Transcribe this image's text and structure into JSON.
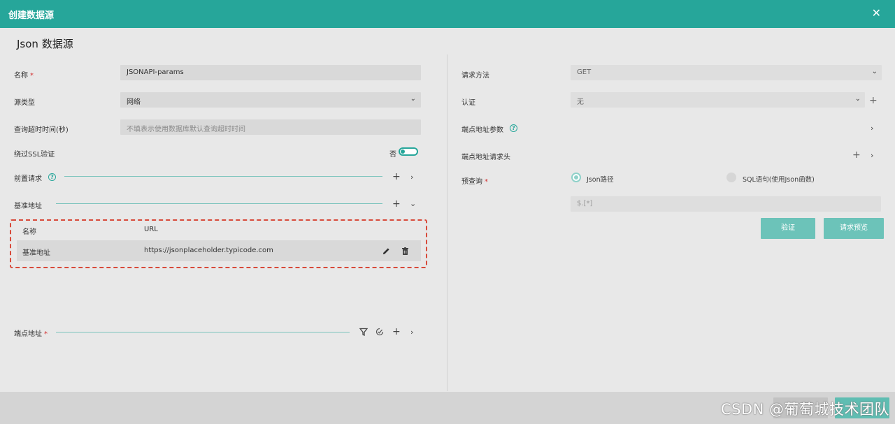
{
  "dialog": {
    "title": "创建数据源"
  },
  "heading": "Json 数据源",
  "left": {
    "name_label": "名称",
    "name_value": "JSONAPI-params",
    "source_type_label": "源类型",
    "source_type_value": "网络",
    "timeout_label": "查询超时时间(秒)",
    "timeout_placeholder": "不填表示使用数据库默认查询超时时间",
    "ssl_label": "绕过SSL验证",
    "ssl_state": "否",
    "pre_request_label": "前置请求",
    "base_url_label": "基准地址",
    "table": {
      "headers": [
        "名称",
        "URL"
      ],
      "rows": [
        {
          "name": "基准地址",
          "url": "https://jsonplaceholder.typicode.com"
        }
      ]
    },
    "endpoint_label": "端点地址"
  },
  "right": {
    "method_label": "请求方法",
    "method_value": "GET",
    "auth_label": "认证",
    "auth_value": "无",
    "endpoint_params_label": "端点地址参数",
    "endpoint_headers_label": "端点地址请求头",
    "pre_query_label": "预查询",
    "radio_json": "Json路径",
    "radio_sql": "SQL语句(使用Json函数)",
    "json_path_placeholder": "$.[*]",
    "verify_button": "验证",
    "preview_button": "请求预览"
  },
  "watermark": "CSDN @葡萄城技术团队",
  "colors": {
    "accent": "#26a69a",
    "required": "#d32f2f",
    "highlight_border": "#d84a3a"
  },
  "icons": [
    "close-icon",
    "chevron-down-icon",
    "help-icon",
    "plus-icon",
    "chevron-right-icon",
    "edit-icon",
    "delete-icon",
    "filter-icon",
    "check-icon"
  ]
}
